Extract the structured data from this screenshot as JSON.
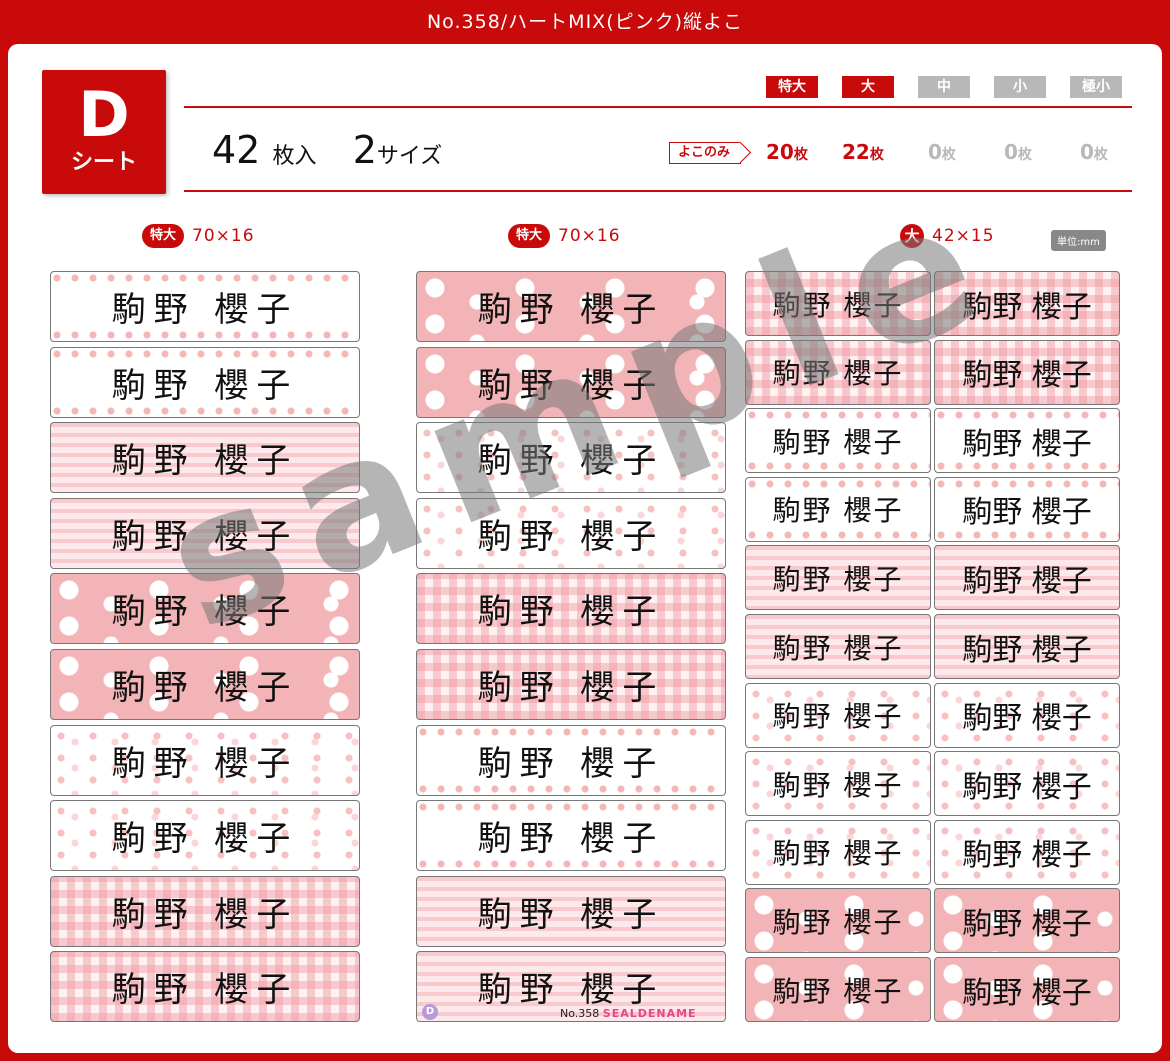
{
  "title": "No.358/ハートMIX(ピンク)縦よこ",
  "sheet": {
    "letter": "D",
    "sub": "シート"
  },
  "summary": {
    "count_num": "42",
    "count_unit": "枚入",
    "size_num": "2",
    "size_unit": "サイズ"
  },
  "size_tabs": [
    {
      "label": "特大",
      "active": true
    },
    {
      "label": "大",
      "active": true
    },
    {
      "label": "中",
      "active": false
    },
    {
      "label": "小",
      "active": false
    },
    {
      "label": "極小",
      "active": false
    }
  ],
  "yoko_only": "よこのみ",
  "quantities": [
    {
      "num": "20",
      "unit": "枚",
      "active": true
    },
    {
      "num": "22",
      "unit": "枚",
      "active": true
    },
    {
      "num": "0",
      "unit": "枚",
      "active": false
    },
    {
      "num": "0",
      "unit": "枚",
      "active": false
    },
    {
      "num": "0",
      "unit": "枚",
      "active": false
    }
  ],
  "columns": [
    {
      "badge": "特大",
      "dims": "70×16"
    },
    {
      "badge": "特大",
      "dims": "70×16"
    },
    {
      "badge": "大",
      "dims": "42×15"
    }
  ],
  "unit": "単位:mm",
  "name": "駒野 櫻子",
  "name_vertical": "駒野 櫻子",
  "watermark": "sample",
  "footer": {
    "sheet_letter": "D",
    "no": "No.358",
    "brand": "SEALDENAME"
  },
  "colors": {
    "brand_red": "#c80a0a",
    "pink": "#f2b4b6",
    "inactive": "#b8b8b8"
  }
}
